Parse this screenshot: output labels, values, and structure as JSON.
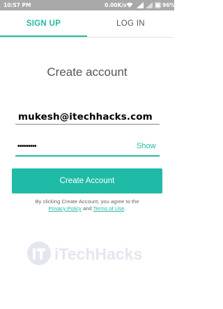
{
  "status_bar": {
    "time": "10:57 PM",
    "speed": "0.00K/s",
    "battery_pct": "96%"
  },
  "tabs": [
    {
      "label": "SIGN UP",
      "active": true
    },
    {
      "label": "LOG IN",
      "active": false
    }
  ],
  "form": {
    "title": "Create account",
    "email_value": "mukesh@itechhacks.com",
    "password_value": "•••••••••",
    "show_label": "Show",
    "submit_label": "Create Account"
  },
  "terms": {
    "prefix": "By clicking Create Account, you agree to the",
    "privacy_label": "Privacy Policy",
    "and": "and",
    "terms_label": "Terms of Use",
    "suffix": "."
  },
  "watermark": {
    "text": "iTechHacks"
  },
  "colors": {
    "accent": "#1fbba6",
    "status_bar": "#a9a9a9"
  }
}
